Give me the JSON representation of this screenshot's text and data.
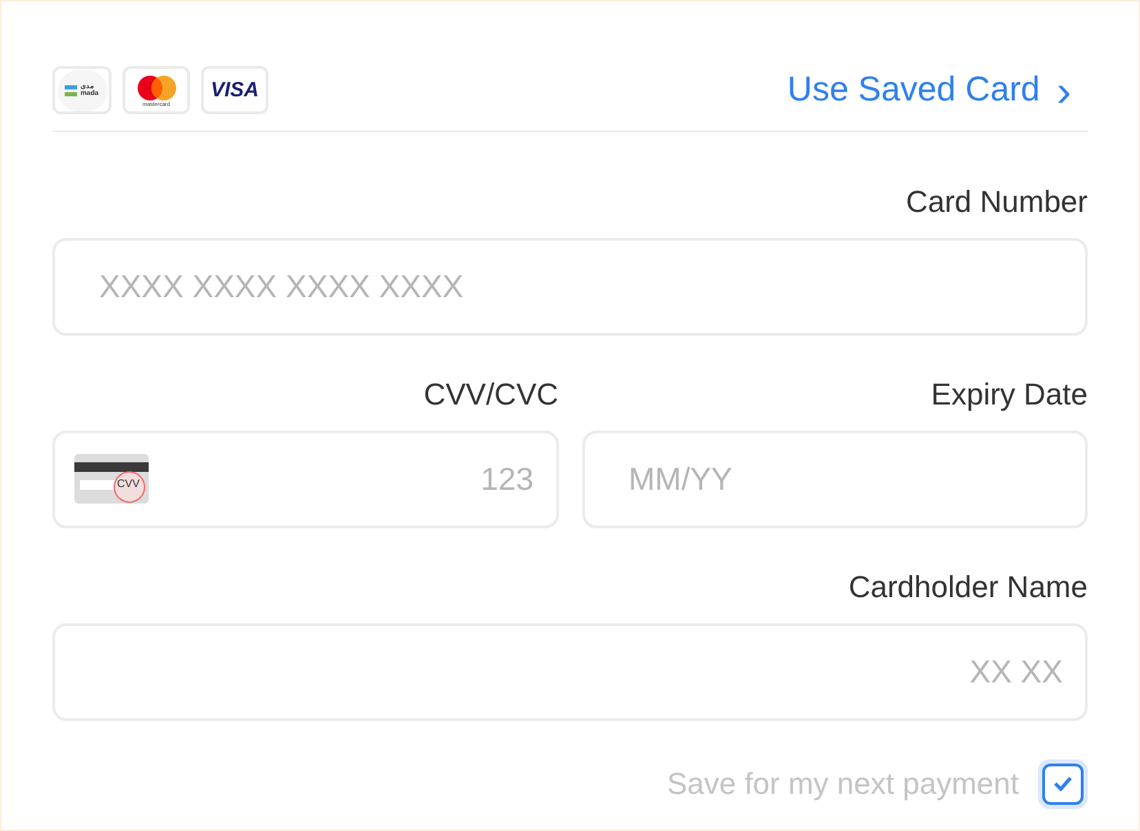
{
  "card_brands": [
    {
      "kind": "mada",
      "latin": "mada",
      "arabic": "مدى"
    },
    {
      "kind": "mastercard",
      "latin": "mastercard"
    },
    {
      "kind": "visa",
      "latin": "VISA"
    }
  ],
  "saved_card_link": {
    "label": "Use Saved Card",
    "icon": "›"
  },
  "card_number": {
    "label": "Card Number",
    "placeholder": "XXXX XXXX XXXX XXXX"
  },
  "cvv": {
    "label": "CVV/CVC",
    "placeholder": "123",
    "icon_text": "CVV"
  },
  "expiry": {
    "label": "Expiry Date",
    "placeholder": "MM/YY"
  },
  "cardholder": {
    "label": "Cardholder Name",
    "placeholder": "XX XX"
  },
  "save_option": {
    "label": "Save for my next payment",
    "checked": true
  }
}
